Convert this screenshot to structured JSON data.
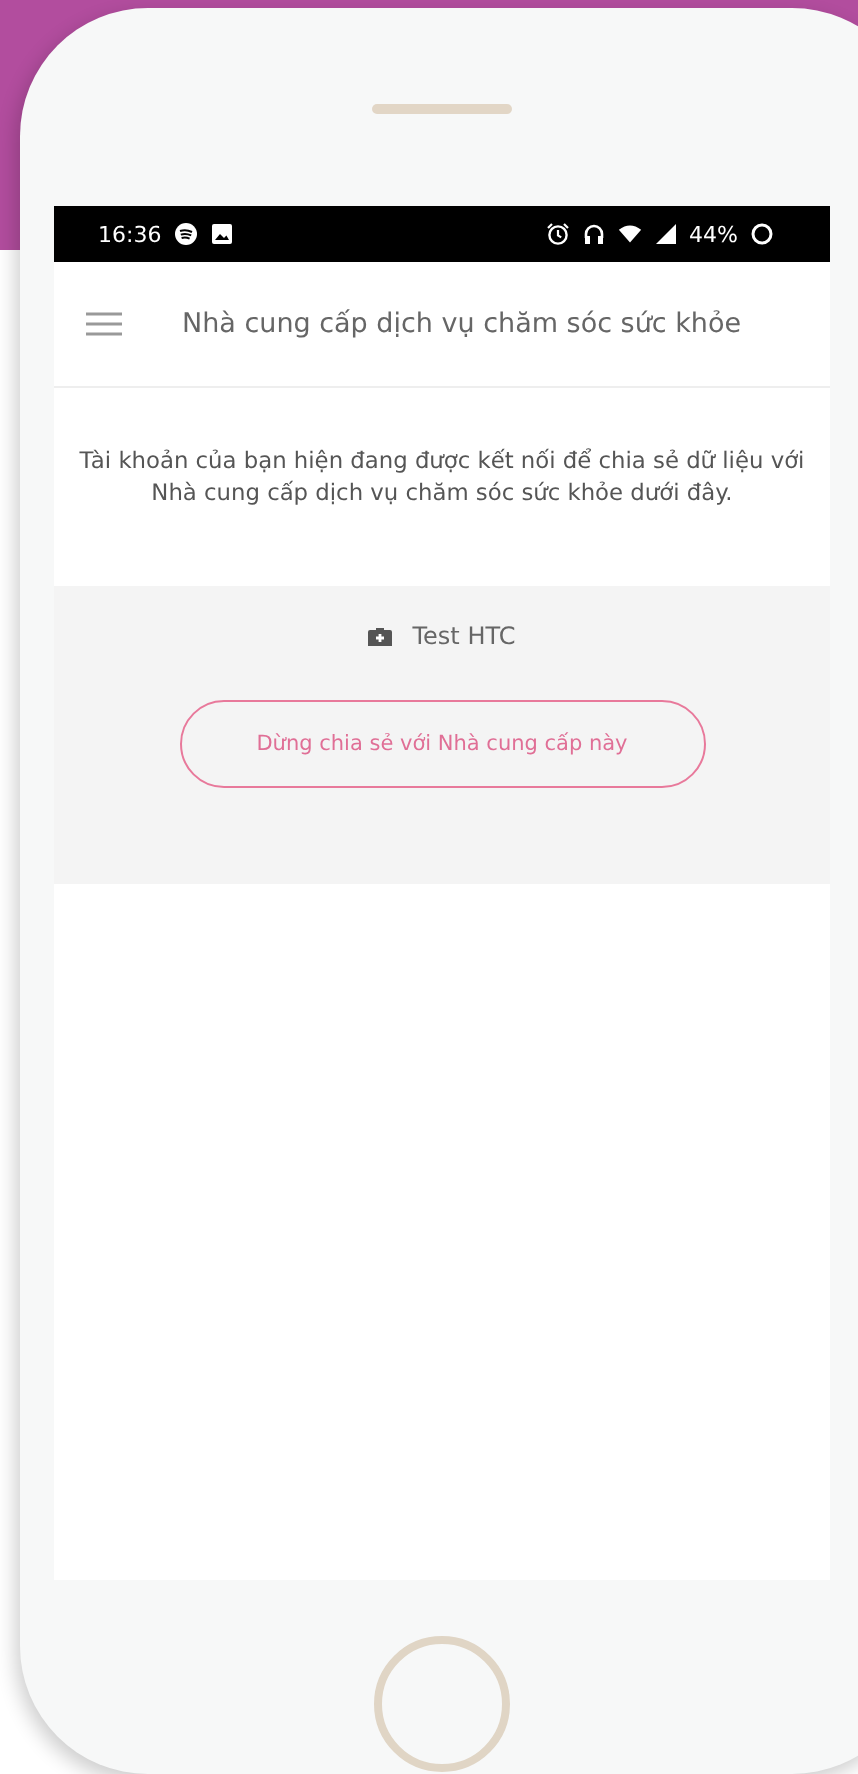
{
  "status_bar": {
    "time": "16:36",
    "battery": "44%"
  },
  "app_bar": {
    "title": "Nhà cung cấp dịch vụ chăm sóc sức khỏe"
  },
  "description": "Tài khoản của bạn hiện đang được kết nối để chia sẻ dữ liệu với Nhà cung cấp dịch vụ chăm sóc sức khỏe dưới đây.",
  "providers": [
    {
      "name": "Test HTC",
      "action": "Dừng chia sẻ với Nhà cung cấp này"
    }
  ]
}
